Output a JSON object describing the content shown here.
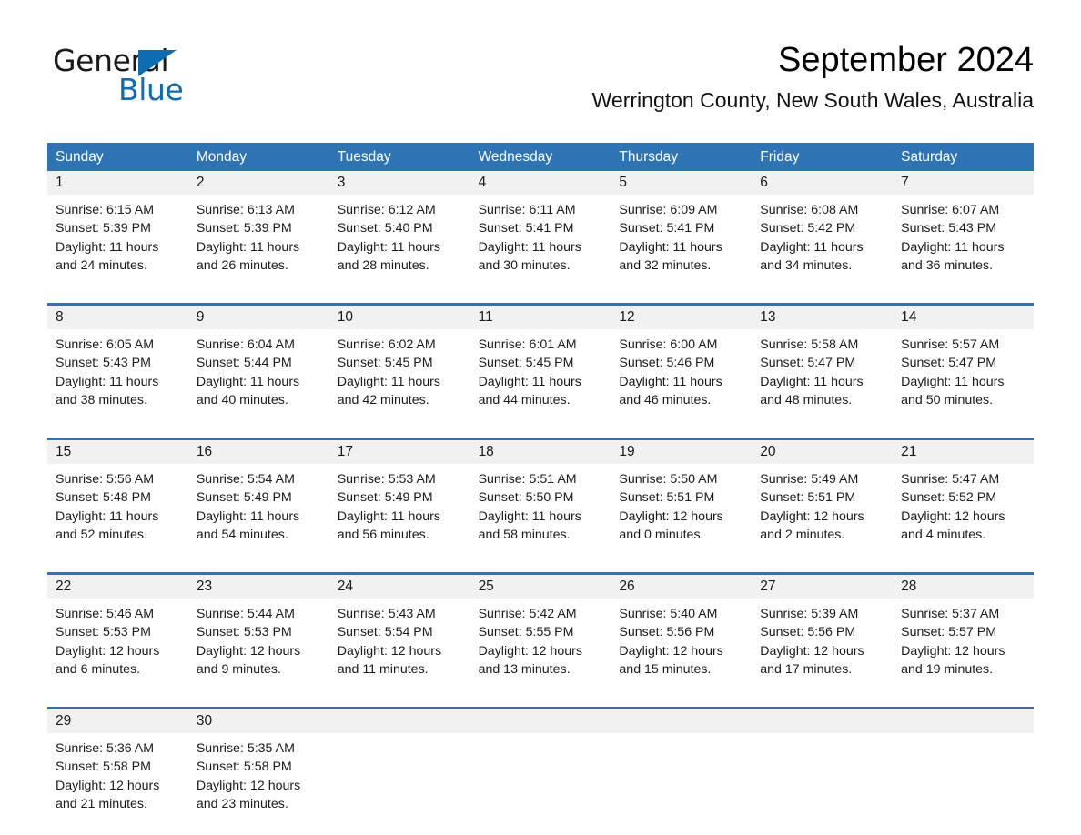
{
  "brand": {
    "word_one": "General",
    "word_two": "Blue",
    "triangle_icon": "blue-triangle-icon",
    "colors": {
      "black": "#1a1a1a",
      "blue": "#0d6cb3"
    }
  },
  "header": {
    "title": "September 2024",
    "subtitle": "Werrington County, New South Wales, Australia"
  },
  "theme": {
    "header_blue": "#2e74b5",
    "date_band_gray": "#f1f1f1",
    "text_black": "#1a1a1a",
    "page_white": "#ffffff"
  },
  "calendar": {
    "weekdays": [
      "Sunday",
      "Monday",
      "Tuesday",
      "Wednesday",
      "Thursday",
      "Friday",
      "Saturday"
    ],
    "weeks": [
      {
        "days": [
          {
            "date": "1",
            "sunrise": "Sunrise: 6:15 AM",
            "sunset": "Sunset: 5:39 PM",
            "daylight_line1": "Daylight: 11 hours",
            "daylight_line2": "and 24 minutes."
          },
          {
            "date": "2",
            "sunrise": "Sunrise: 6:13 AM",
            "sunset": "Sunset: 5:39 PM",
            "daylight_line1": "Daylight: 11 hours",
            "daylight_line2": "and 26 minutes."
          },
          {
            "date": "3",
            "sunrise": "Sunrise: 6:12 AM",
            "sunset": "Sunset: 5:40 PM",
            "daylight_line1": "Daylight: 11 hours",
            "daylight_line2": "and 28 minutes."
          },
          {
            "date": "4",
            "sunrise": "Sunrise: 6:11 AM",
            "sunset": "Sunset: 5:41 PM",
            "daylight_line1": "Daylight: 11 hours",
            "daylight_line2": "and 30 minutes."
          },
          {
            "date": "5",
            "sunrise": "Sunrise: 6:09 AM",
            "sunset": "Sunset: 5:41 PM",
            "daylight_line1": "Daylight: 11 hours",
            "daylight_line2": "and 32 minutes."
          },
          {
            "date": "6",
            "sunrise": "Sunrise: 6:08 AM",
            "sunset": "Sunset: 5:42 PM",
            "daylight_line1": "Daylight: 11 hours",
            "daylight_line2": "and 34 minutes."
          },
          {
            "date": "7",
            "sunrise": "Sunrise: 6:07 AM",
            "sunset": "Sunset: 5:43 PM",
            "daylight_line1": "Daylight: 11 hours",
            "daylight_line2": "and 36 minutes."
          }
        ]
      },
      {
        "days": [
          {
            "date": "8",
            "sunrise": "Sunrise: 6:05 AM",
            "sunset": "Sunset: 5:43 PM",
            "daylight_line1": "Daylight: 11 hours",
            "daylight_line2": "and 38 minutes."
          },
          {
            "date": "9",
            "sunrise": "Sunrise: 6:04 AM",
            "sunset": "Sunset: 5:44 PM",
            "daylight_line1": "Daylight: 11 hours",
            "daylight_line2": "and 40 minutes."
          },
          {
            "date": "10",
            "sunrise": "Sunrise: 6:02 AM",
            "sunset": "Sunset: 5:45 PM",
            "daylight_line1": "Daylight: 11 hours",
            "daylight_line2": "and 42 minutes."
          },
          {
            "date": "11",
            "sunrise": "Sunrise: 6:01 AM",
            "sunset": "Sunset: 5:45 PM",
            "daylight_line1": "Daylight: 11 hours",
            "daylight_line2": "and 44 minutes."
          },
          {
            "date": "12",
            "sunrise": "Sunrise: 6:00 AM",
            "sunset": "Sunset: 5:46 PM",
            "daylight_line1": "Daylight: 11 hours",
            "daylight_line2": "and 46 minutes."
          },
          {
            "date": "13",
            "sunrise": "Sunrise: 5:58 AM",
            "sunset": "Sunset: 5:47 PM",
            "daylight_line1": "Daylight: 11 hours",
            "daylight_line2": "and 48 minutes."
          },
          {
            "date": "14",
            "sunrise": "Sunrise: 5:57 AM",
            "sunset": "Sunset: 5:47 PM",
            "daylight_line1": "Daylight: 11 hours",
            "daylight_line2": "and 50 minutes."
          }
        ]
      },
      {
        "days": [
          {
            "date": "15",
            "sunrise": "Sunrise: 5:56 AM",
            "sunset": "Sunset: 5:48 PM",
            "daylight_line1": "Daylight: 11 hours",
            "daylight_line2": "and 52 minutes."
          },
          {
            "date": "16",
            "sunrise": "Sunrise: 5:54 AM",
            "sunset": "Sunset: 5:49 PM",
            "daylight_line1": "Daylight: 11 hours",
            "daylight_line2": "and 54 minutes."
          },
          {
            "date": "17",
            "sunrise": "Sunrise: 5:53 AM",
            "sunset": "Sunset: 5:49 PM",
            "daylight_line1": "Daylight: 11 hours",
            "daylight_line2": "and 56 minutes."
          },
          {
            "date": "18",
            "sunrise": "Sunrise: 5:51 AM",
            "sunset": "Sunset: 5:50 PM",
            "daylight_line1": "Daylight: 11 hours",
            "daylight_line2": "and 58 minutes."
          },
          {
            "date": "19",
            "sunrise": "Sunrise: 5:50 AM",
            "sunset": "Sunset: 5:51 PM",
            "daylight_line1": "Daylight: 12 hours",
            "daylight_line2": "and 0 minutes."
          },
          {
            "date": "20",
            "sunrise": "Sunrise: 5:49 AM",
            "sunset": "Sunset: 5:51 PM",
            "daylight_line1": "Daylight: 12 hours",
            "daylight_line2": "and 2 minutes."
          },
          {
            "date": "21",
            "sunrise": "Sunrise: 5:47 AM",
            "sunset": "Sunset: 5:52 PM",
            "daylight_line1": "Daylight: 12 hours",
            "daylight_line2": "and 4 minutes."
          }
        ]
      },
      {
        "days": [
          {
            "date": "22",
            "sunrise": "Sunrise: 5:46 AM",
            "sunset": "Sunset: 5:53 PM",
            "daylight_line1": "Daylight: 12 hours",
            "daylight_line2": "and 6 minutes."
          },
          {
            "date": "23",
            "sunrise": "Sunrise: 5:44 AM",
            "sunset": "Sunset: 5:53 PM",
            "daylight_line1": "Daylight: 12 hours",
            "daylight_line2": "and 9 minutes."
          },
          {
            "date": "24",
            "sunrise": "Sunrise: 5:43 AM",
            "sunset": "Sunset: 5:54 PM",
            "daylight_line1": "Daylight: 12 hours",
            "daylight_line2": "and 11 minutes."
          },
          {
            "date": "25",
            "sunrise": "Sunrise: 5:42 AM",
            "sunset": "Sunset: 5:55 PM",
            "daylight_line1": "Daylight: 12 hours",
            "daylight_line2": "and 13 minutes."
          },
          {
            "date": "26",
            "sunrise": "Sunrise: 5:40 AM",
            "sunset": "Sunset: 5:56 PM",
            "daylight_line1": "Daylight: 12 hours",
            "daylight_line2": "and 15 minutes."
          },
          {
            "date": "27",
            "sunrise": "Sunrise: 5:39 AM",
            "sunset": "Sunset: 5:56 PM",
            "daylight_line1": "Daylight: 12 hours",
            "daylight_line2": "and 17 minutes."
          },
          {
            "date": "28",
            "sunrise": "Sunrise: 5:37 AM",
            "sunset": "Sunset: 5:57 PM",
            "daylight_line1": "Daylight: 12 hours",
            "daylight_line2": "and 19 minutes."
          }
        ]
      },
      {
        "days": [
          {
            "date": "29",
            "sunrise": "Sunrise: 5:36 AM",
            "sunset": "Sunset: 5:58 PM",
            "daylight_line1": "Daylight: 12 hours",
            "daylight_line2": "and 21 minutes."
          },
          {
            "date": "30",
            "sunrise": "Sunrise: 5:35 AM",
            "sunset": "Sunset: 5:58 PM",
            "daylight_line1": "Daylight: 12 hours",
            "daylight_line2": "and 23 minutes."
          },
          {
            "date": "",
            "sunrise": "",
            "sunset": "",
            "daylight_line1": "",
            "daylight_line2": ""
          },
          {
            "date": "",
            "sunrise": "",
            "sunset": "",
            "daylight_line1": "",
            "daylight_line2": ""
          },
          {
            "date": "",
            "sunrise": "",
            "sunset": "",
            "daylight_line1": "",
            "daylight_line2": ""
          },
          {
            "date": "",
            "sunrise": "",
            "sunset": "",
            "daylight_line1": "",
            "daylight_line2": ""
          },
          {
            "date": "",
            "sunrise": "",
            "sunset": "",
            "daylight_line1": "",
            "daylight_line2": ""
          }
        ]
      }
    ]
  }
}
